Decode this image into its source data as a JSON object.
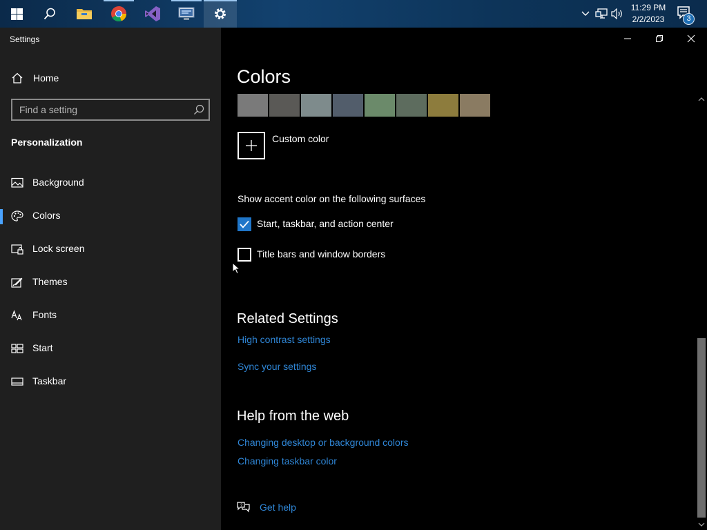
{
  "taskbar": {
    "apps": [
      {
        "name": "start-button",
        "icon": "windows-logo-icon"
      },
      {
        "name": "search-button",
        "icon": "search-icon"
      },
      {
        "name": "file-explorer",
        "icon": "folder-icon"
      },
      {
        "name": "chrome",
        "icon": "chrome-icon"
      },
      {
        "name": "visual-studio",
        "icon": "visual-studio-icon"
      },
      {
        "name": "network-app",
        "icon": "remote-desktop-icon"
      },
      {
        "name": "settings-app",
        "icon": "gear-icon"
      }
    ],
    "clock": {
      "time": "11:29 PM",
      "date": "2/2/2023"
    },
    "notification_count": "3"
  },
  "window": {
    "title": "Settings"
  },
  "sidebar": {
    "home_label": "Home",
    "search_placeholder": "Find a setting",
    "section_title": "Personalization",
    "items": [
      {
        "label": "Background",
        "icon": "image-icon"
      },
      {
        "label": "Colors",
        "icon": "palette-icon",
        "selected": true
      },
      {
        "label": "Lock screen",
        "icon": "lock-screen-icon"
      },
      {
        "label": "Themes",
        "icon": "themes-icon"
      },
      {
        "label": "Fonts",
        "icon": "fonts-icon"
      },
      {
        "label": "Start",
        "icon": "start-icon"
      },
      {
        "label": "Taskbar",
        "icon": "taskbar-icon"
      }
    ]
  },
  "content": {
    "title": "Colors",
    "swatches": [
      "#7a7a7a",
      "#5a5956",
      "#7e8b8c",
      "#525d6b",
      "#6b8a6a",
      "#5d6c5e",
      "#8d7c3d",
      "#8a7b62"
    ],
    "custom_color_label": "Custom color",
    "accent_surfaces_label": "Show accent color on the following surfaces",
    "checkbox_start": {
      "label": "Start, taskbar, and action center",
      "checked": true
    },
    "checkbox_title_bars": {
      "label": "Title bars and window borders",
      "checked": false
    },
    "related_settings": {
      "title": "Related Settings",
      "links": [
        "High contrast settings",
        "Sync your settings"
      ]
    },
    "help": {
      "title": "Help from the web",
      "links": [
        "Changing desktop or background colors",
        "Changing taskbar color"
      ]
    },
    "get_help": "Get help"
  },
  "colors": {
    "accent": "#1f76c9",
    "link": "#2f86d6",
    "sidebar_bg": "#1f1f1f",
    "content_bg": "#000000"
  }
}
